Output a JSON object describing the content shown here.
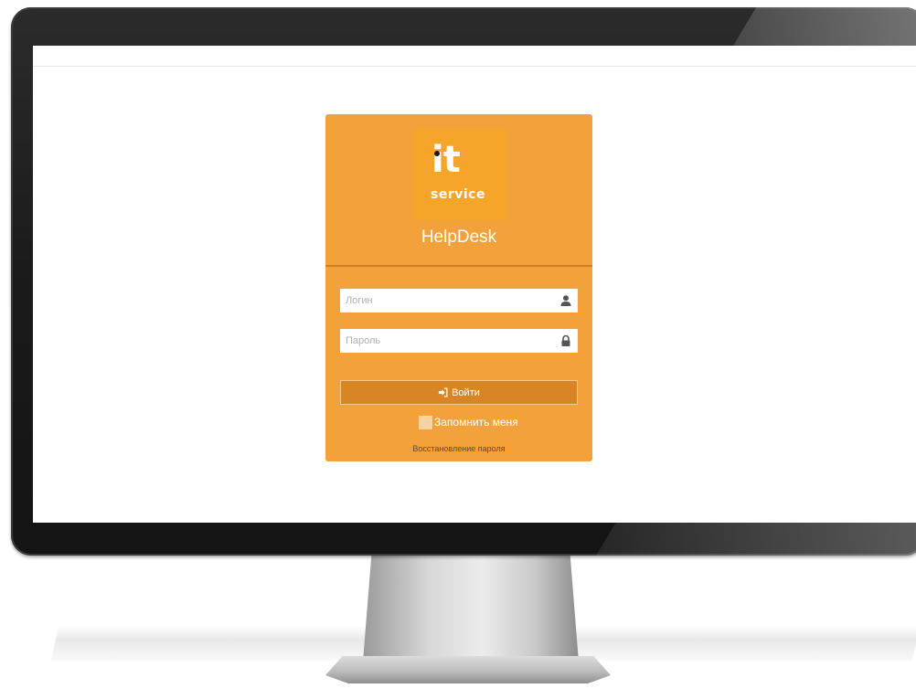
{
  "brand": {
    "logo_word": "it",
    "logo_sub": "service",
    "app_title": "HelpDesk"
  },
  "login_form": {
    "login_placeholder": "Логин",
    "login_value": "",
    "login_icon": "user-icon",
    "password_placeholder": "Пароль",
    "password_value": "",
    "password_icon": "lock-icon",
    "submit_label": "Войти",
    "submit_icon": "sign-in-icon",
    "remember_label": "Запомнить меня",
    "remember_checked": false,
    "recover_label": "Восстановление пароля"
  },
  "colors": {
    "card_bg": "#f3a23b",
    "button_bg": "#d98525",
    "divider": "#cf7f1f"
  }
}
